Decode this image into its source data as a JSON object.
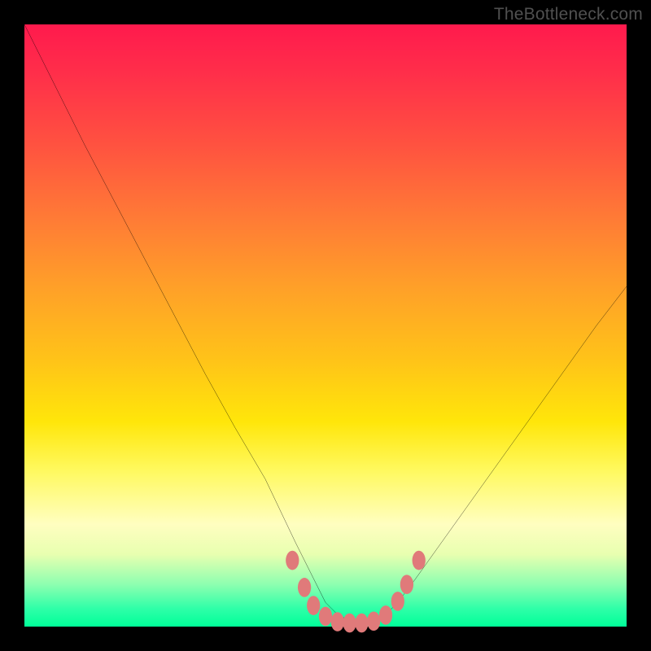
{
  "watermark": "TheBottleneck.com",
  "chart_data": {
    "type": "line",
    "title": "",
    "xlabel": "",
    "ylabel": "",
    "xlim": [
      0,
      100
    ],
    "ylim": [
      0,
      100
    ],
    "grid": false,
    "series": [
      {
        "name": "bottleneck-curve",
        "x": [
          0,
          5,
          10,
          15,
          20,
          25,
          30,
          35,
          40,
          45,
          48,
          50,
          52,
          55,
          58,
          60,
          62,
          65,
          70,
          75,
          80,
          85,
          90,
          95,
          100
        ],
        "y": [
          100,
          90,
          80,
          70.5,
          61,
          51.5,
          42,
          33,
          24.5,
          14,
          8,
          4,
          2,
          0.5,
          0.5,
          2,
          4,
          8,
          15,
          22,
          29,
          36,
          43,
          50,
          56.5
        ]
      }
    ],
    "markers": {
      "name": "highlight-points",
      "color": "#e07a7a",
      "points": [
        {
          "x": 44.5,
          "y": 11
        },
        {
          "x": 46.5,
          "y": 6.5
        },
        {
          "x": 48,
          "y": 3.5
        },
        {
          "x": 50,
          "y": 1.7
        },
        {
          "x": 52,
          "y": 0.8
        },
        {
          "x": 54,
          "y": 0.6
        },
        {
          "x": 56,
          "y": 0.6
        },
        {
          "x": 58,
          "y": 0.9
        },
        {
          "x": 60,
          "y": 1.9
        },
        {
          "x": 62,
          "y": 4.2
        },
        {
          "x": 63.5,
          "y": 7
        },
        {
          "x": 65.5,
          "y": 11
        }
      ]
    },
    "gradient_stops": [
      {
        "pct": 0,
        "color": "#ff1a4d"
      },
      {
        "pct": 8,
        "color": "#ff2e4a"
      },
      {
        "pct": 20,
        "color": "#ff5240"
      },
      {
        "pct": 32,
        "color": "#ff7a36"
      },
      {
        "pct": 44,
        "color": "#ffa128"
      },
      {
        "pct": 56,
        "color": "#ffc418"
      },
      {
        "pct": 66,
        "color": "#ffe60a"
      },
      {
        "pct": 74,
        "color": "#fff95e"
      },
      {
        "pct": 83,
        "color": "#fffec0"
      },
      {
        "pct": 88,
        "color": "#e8ffb0"
      },
      {
        "pct": 93,
        "color": "#8dffb0"
      },
      {
        "pct": 97,
        "color": "#2fffa8"
      },
      {
        "pct": 100,
        "color": "#00ff99"
      }
    ]
  }
}
